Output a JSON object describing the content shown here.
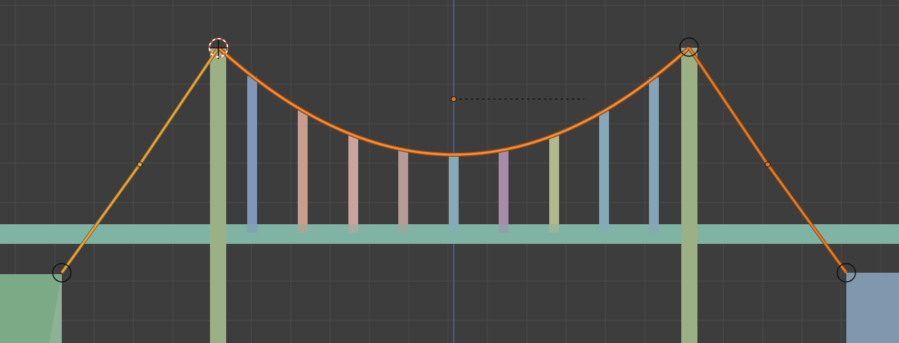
{
  "viewport": {
    "name": "3D Viewport",
    "background_color": "#3d3d3d",
    "grid_color": "#4a4a4a",
    "axis_color": "#4a72c8"
  },
  "scene_objects": {
    "left_abutment": {
      "color": "#7fb08a"
    },
    "right_abutment": {
      "color": "#7f98ae"
    },
    "tower_left": {
      "color": "#9bb185"
    },
    "tower_right": {
      "color": "#9bb185"
    },
    "deck": {
      "color": "#7fb3a4"
    },
    "hangers": [
      {
        "id": "hanger-1",
        "color": "#7f98b8"
      },
      {
        "id": "hanger-2",
        "color": "#c79d8f"
      },
      {
        "id": "hanger-3",
        "color": "#c9a39c"
      },
      {
        "id": "hanger-4",
        "color": "#b59a95"
      },
      {
        "id": "hanger-5",
        "color": "#86a9b8"
      },
      {
        "id": "hanger-6",
        "color": "#a88aa9"
      },
      {
        "id": "hanger-7",
        "color": "#b1b88e"
      },
      {
        "id": "hanger-8",
        "color": "#86a9b8"
      },
      {
        "id": "hanger-9",
        "color": "#86a4b8"
      }
    ]
  },
  "curves": {
    "left_back_stay": {
      "color": "#e6a43a",
      "selected": true
    },
    "main_cable": {
      "color": "#e87a22",
      "selected": true
    },
    "right_back_stay": {
      "color": "#e87a22",
      "selected": true
    },
    "control_points": 4,
    "handle_points": 3
  },
  "cursor": {
    "type": "3d-cursor",
    "color": "#e87a22"
  }
}
